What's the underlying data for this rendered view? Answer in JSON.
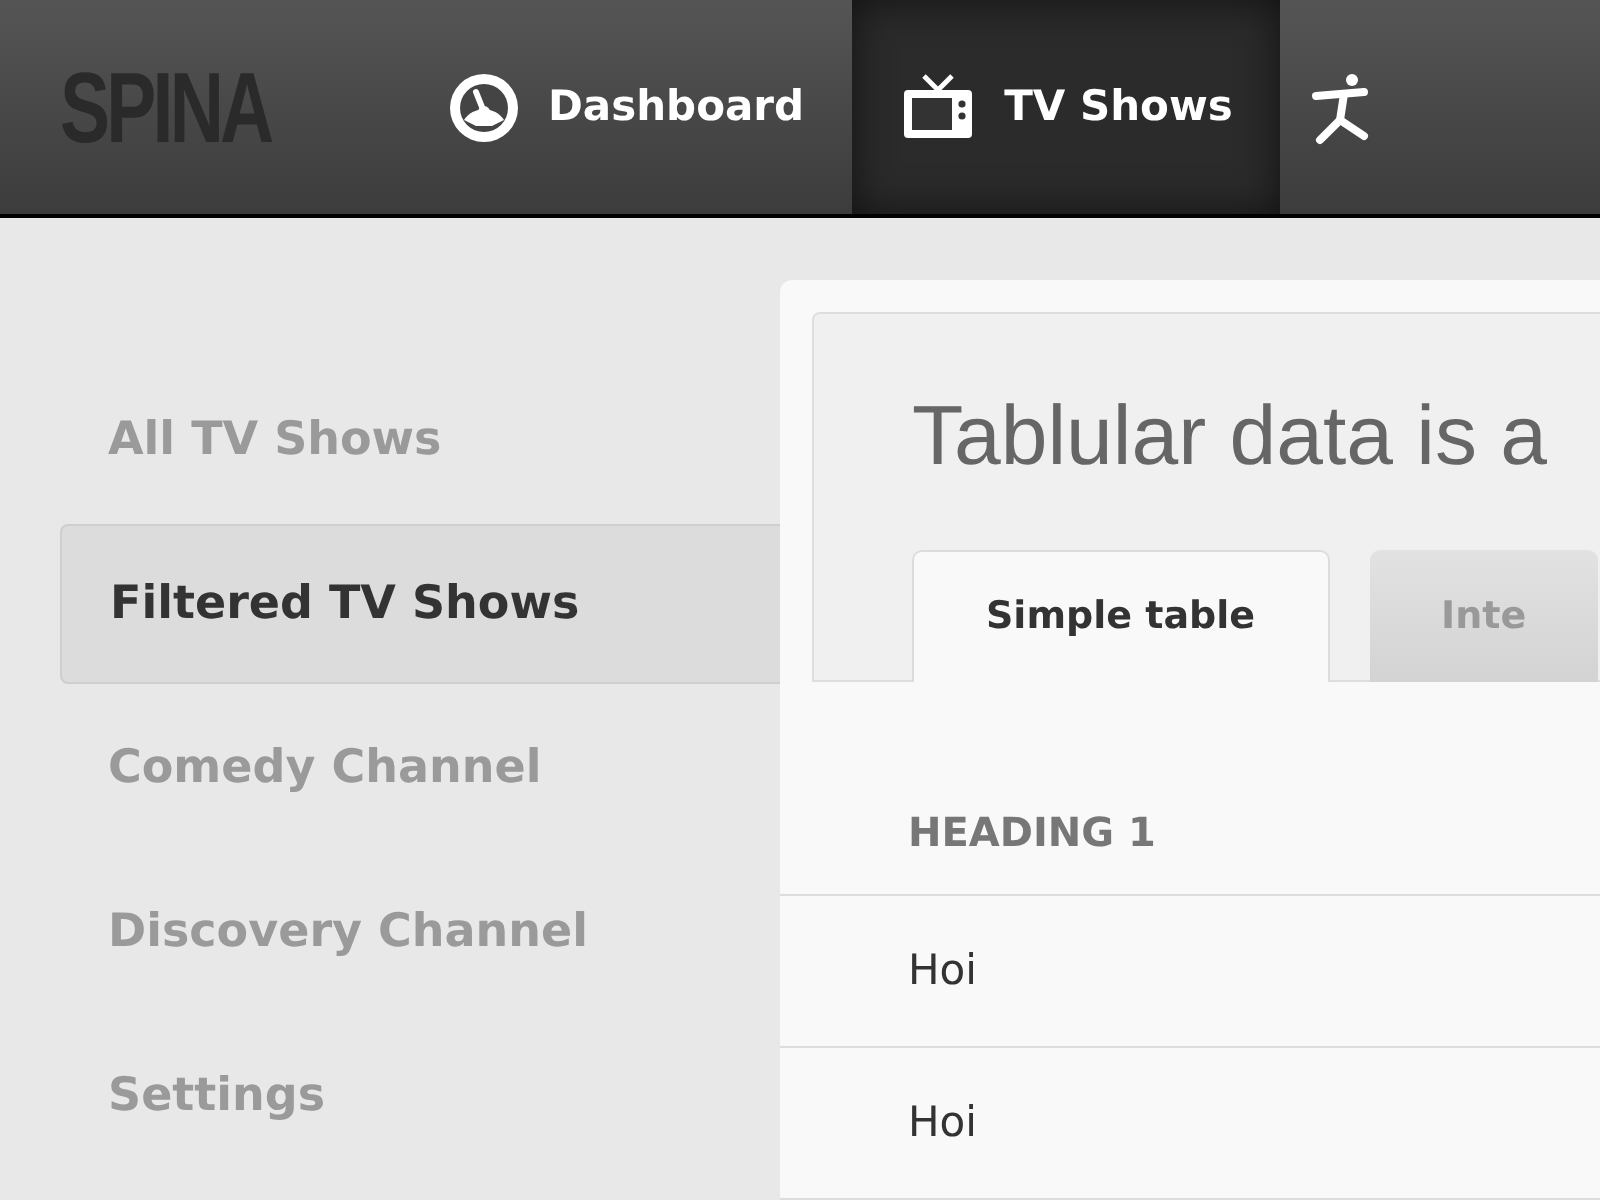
{
  "header": {
    "logo": "SPINA",
    "nav": [
      {
        "kind": "gauge",
        "label": "Dashboard",
        "selected": false
      },
      {
        "kind": "tv",
        "label": "TV Shows",
        "selected": true
      },
      {
        "kind": "figure",
        "selected": false
      }
    ]
  },
  "sidebar": {
    "items": [
      {
        "label": "All TV Shows",
        "selected": false
      },
      {
        "label": "Filtered TV Shows",
        "selected": true
      },
      {
        "label": "Comedy Channel",
        "selected": false
      },
      {
        "label": "Discovery Channel",
        "selected": false
      },
      {
        "label": "Settings",
        "selected": false
      }
    ]
  },
  "content": {
    "title": "Tablular data is a",
    "tabs": [
      {
        "label": "Simple table",
        "selected": true
      },
      {
        "label": "Inte",
        "selected": false
      }
    ],
    "table": {
      "columns": [
        "HEADING 1"
      ],
      "rows": [
        [
          "Hoi"
        ],
        [
          "Hoi"
        ]
      ]
    }
  }
}
